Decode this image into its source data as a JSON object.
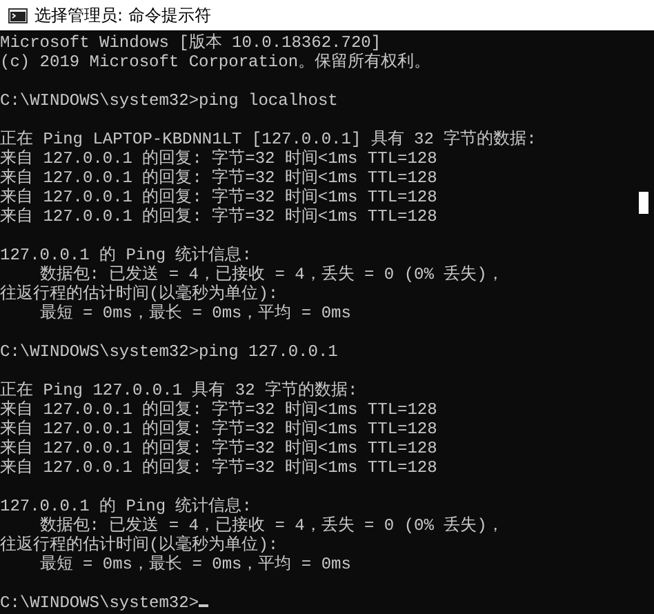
{
  "window": {
    "title": "选择管理员: 命令提示符"
  },
  "console": {
    "blocks": [
      [
        "Microsoft Windows [版本 10.0.18362.720]",
        "(c) 2019 Microsoft Corporation。保留所有权利。"
      ],
      [
        "C:\\WINDOWS\\system32>ping localhost"
      ],
      [
        "正在 Ping LAPTOP-KBDNN1LT [127.0.0.1] 具有 32 字节的数据:",
        "来自 127.0.0.1 的回复: 字节=32 时间<1ms TTL=128",
        "来自 127.0.0.1 的回复: 字节=32 时间<1ms TTL=128",
        "来自 127.0.0.1 的回复: 字节=32 时间<1ms TTL=128",
        "来自 127.0.0.1 的回复: 字节=32 时间<1ms TTL=128"
      ],
      [
        "127.0.0.1 的 Ping 统计信息:",
        "    数据包: 已发送 = 4，已接收 = 4，丢失 = 0 (0% 丢失)，",
        "往返行程的估计时间(以毫秒为单位):",
        "    最短 = 0ms，最长 = 0ms，平均 = 0ms"
      ],
      [
        "C:\\WINDOWS\\system32>ping 127.0.0.1"
      ],
      [
        "正在 Ping 127.0.0.1 具有 32 字节的数据:",
        "来自 127.0.0.1 的回复: 字节=32 时间<1ms TTL=128",
        "来自 127.0.0.1 的回复: 字节=32 时间<1ms TTL=128",
        "来自 127.0.0.1 的回复: 字节=32 时间<1ms TTL=128",
        "来自 127.0.0.1 的回复: 字节=32 时间<1ms TTL=128"
      ],
      [
        "127.0.0.1 的 Ping 统计信息:",
        "    数据包: 已发送 = 4，已接收 = 4，丢失 = 0 (0% 丢失)，",
        "往返行程的估计时间(以毫秒为单位):",
        "    最短 = 0ms，最长 = 0ms，平均 = 0ms"
      ]
    ],
    "prompt": "C:\\WINDOWS\\system32>"
  }
}
